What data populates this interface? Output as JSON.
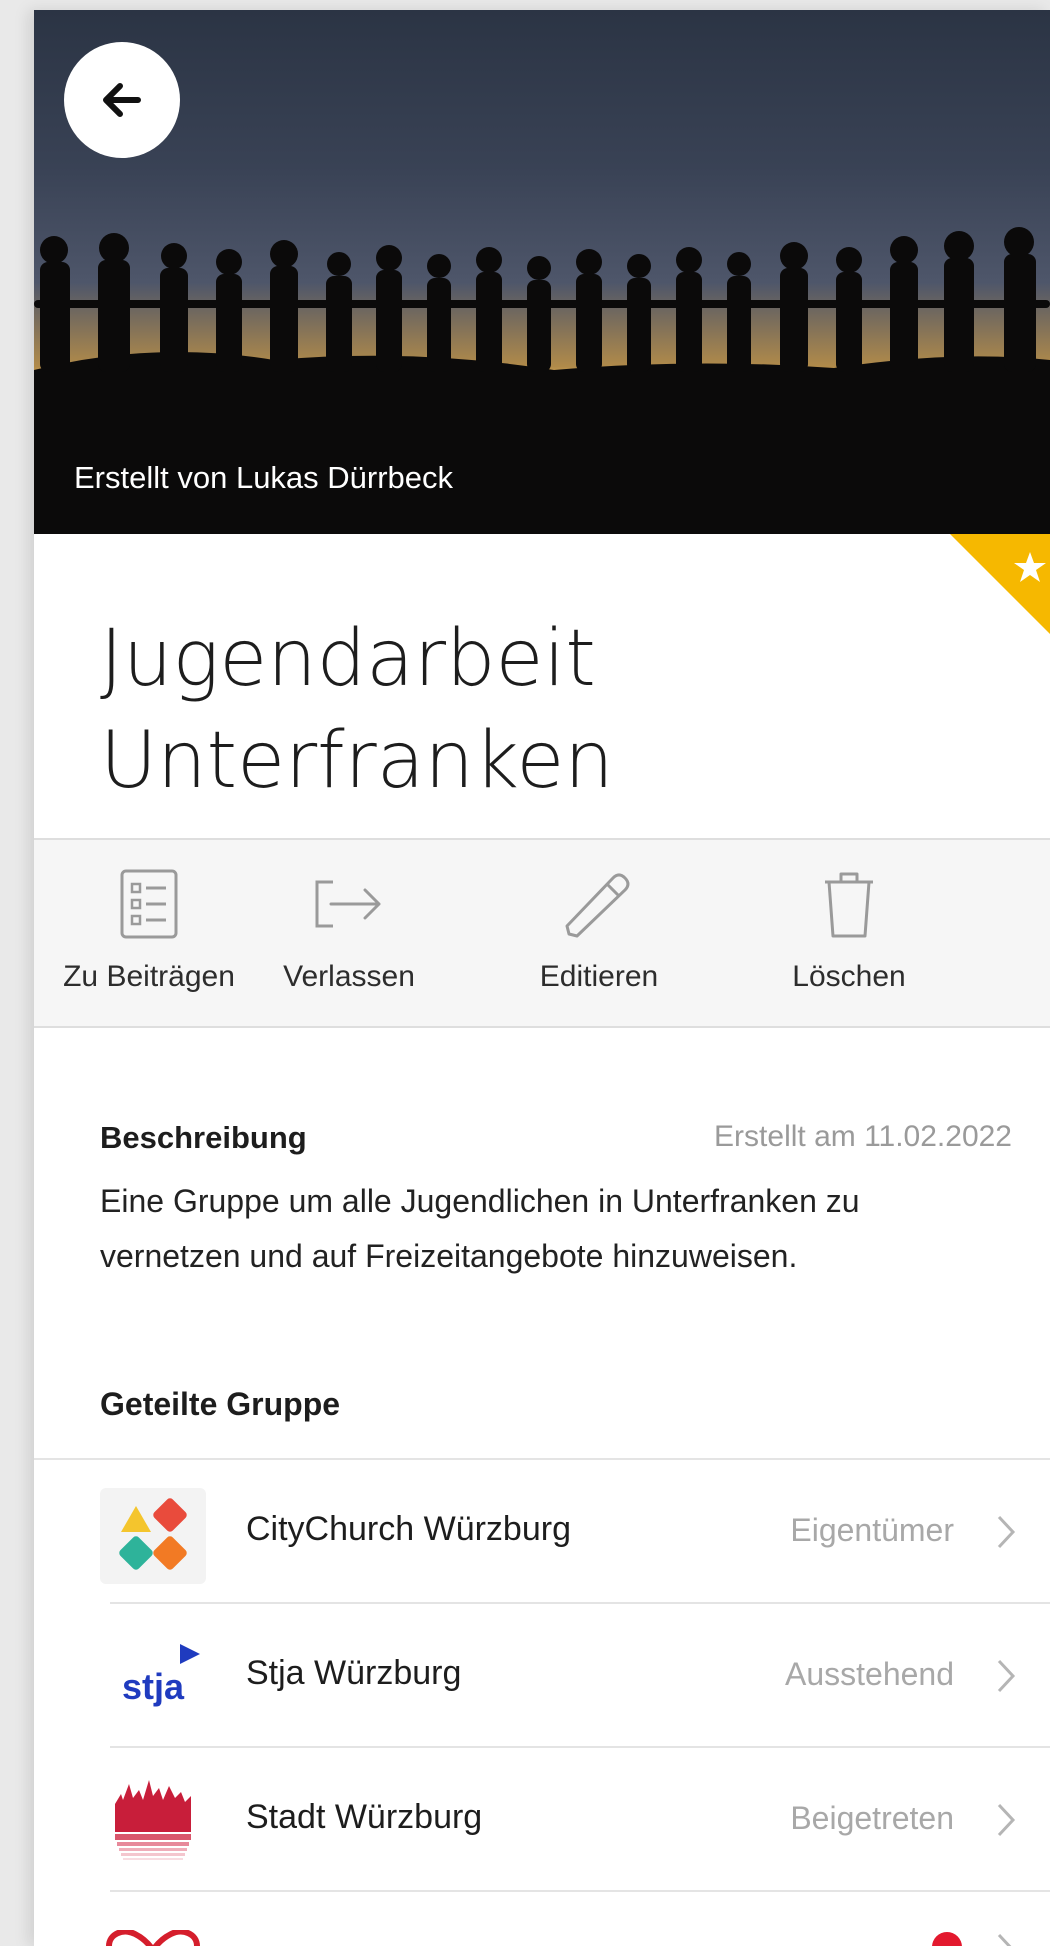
{
  "hero": {
    "credit": "Erstellt von Lukas Dürrbeck",
    "back_icon": "arrow-left-icon"
  },
  "group": {
    "title_line1": "Jugendarbeit",
    "title_line2": "Unterfranken",
    "favorite_icon": "star-icon",
    "favorite_color": "#f6b800"
  },
  "actions": [
    {
      "label": "Zu Beiträgen",
      "icon": "list-icon"
    },
    {
      "label": "Verlassen",
      "icon": "exit-arrow-icon"
    },
    {
      "label": "Editieren",
      "icon": "pencil-icon"
    },
    {
      "label": "Löschen",
      "icon": "trash-icon"
    }
  ],
  "description": {
    "heading": "Beschreibung",
    "created": "Erstellt am 11.02.2022",
    "text": "Eine Gruppe um alle Jugendlichen in Unterfranken zu vernetzen und auf Freizeitangebote hinzuweisen."
  },
  "shared": {
    "heading": "Geteilte Gruppe",
    "items": [
      {
        "name": "CityChurch Würzburg",
        "status": "Eigentümer",
        "logo": "citychurch-logo"
      },
      {
        "name": "Stja Würzburg",
        "status": "Ausstehend",
        "logo": "stja-logo",
        "logo_text": "stja"
      },
      {
        "name": "Stadt Würzburg",
        "status": "Beigetreten",
        "logo": "stadt-wuerzburg-logo"
      },
      {
        "name": "",
        "status": "",
        "logo": "heart-logo"
      }
    ]
  }
}
